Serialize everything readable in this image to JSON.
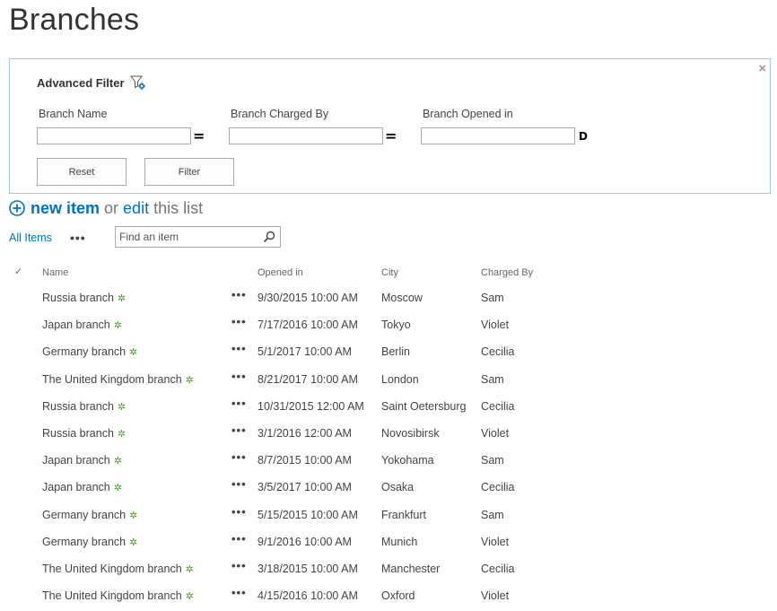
{
  "page": {
    "title": "Branches"
  },
  "filter": {
    "title": "Advanced Filter",
    "close_label": "×",
    "fields": [
      {
        "label": "Branch Name",
        "value": "",
        "operator": "="
      },
      {
        "label": "Branch Charged By",
        "value": "",
        "operator": "="
      },
      {
        "label": "Branch Opened in",
        "value": "",
        "operator": "D"
      }
    ],
    "reset_label": "Reset",
    "filter_label": "Filter"
  },
  "toolbar": {
    "new_item_label": "new item",
    "or_label": "or",
    "edit_label": "edit",
    "this_list_label": "this list"
  },
  "views": {
    "current": "All Items",
    "more_label": "•••",
    "search_placeholder": "Find an item"
  },
  "list": {
    "columns": {
      "check": "✓",
      "name": "Name",
      "opened": "Opened in",
      "city": "City",
      "charged": "Charged By"
    },
    "new_marker": "✲",
    "ellipsis": "•••",
    "rows": [
      {
        "name": "Russia branch",
        "opened": "9/30/2015 10:00 AM",
        "city": "Moscow",
        "charged": "Sam"
      },
      {
        "name": "Japan branch",
        "opened": "7/17/2016 10:00 AM",
        "city": "Tokyo",
        "charged": "Violet"
      },
      {
        "name": "Germany branch",
        "opened": "5/1/2017 10:00 AM",
        "city": "Berlin",
        "charged": "Cecilia"
      },
      {
        "name": "The United Kingdom branch",
        "opened": "8/21/2017 10:00 AM",
        "city": "London",
        "charged": "Sam"
      },
      {
        "name": "Russia branch",
        "opened": "10/31/2015 12:00 AM",
        "city": "Saint Oetersburg",
        "charged": "Cecilia"
      },
      {
        "name": "Russia branch",
        "opened": "3/1/2016 12:00 AM",
        "city": "Novosibirsk",
        "charged": "Violet"
      },
      {
        "name": "Japan branch",
        "opened": "8/7/2015 10:00 AM",
        "city": "Yokohama",
        "charged": "Sam"
      },
      {
        "name": "Japan branch",
        "opened": "3/5/2017 10:00 AM",
        "city": "Osaka",
        "charged": "Cecilia"
      },
      {
        "name": "Germany branch",
        "opened": "5/15/2015 10:00 AM",
        "city": "Frankfurt",
        "charged": "Sam"
      },
      {
        "name": "Germany branch",
        "opened": "9/1/2016 10:00 AM",
        "city": "Munich",
        "charged": "Violet"
      },
      {
        "name": "The United Kingdom branch",
        "opened": "3/18/2015 10:00 AM",
        "city": "Manchester",
        "charged": "Cecilia"
      },
      {
        "name": "The United Kingdom branch",
        "opened": "4/15/2016 10:00 AM",
        "city": "Oxford",
        "charged": "Violet"
      }
    ]
  },
  "colors": {
    "accent": "#0072c6",
    "panel_border": "#9dcbd9",
    "new_marker": "#4a9c2e"
  }
}
